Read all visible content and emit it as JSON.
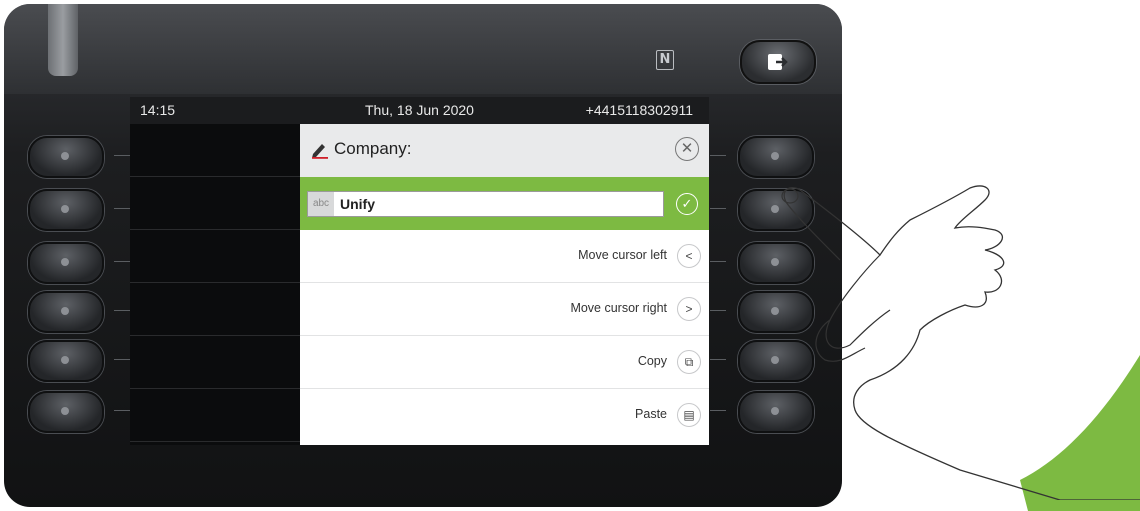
{
  "status_bar": {
    "time": "14:15",
    "date": "Thu, 18 Jun 2020",
    "number": "+4415118302911"
  },
  "panel": {
    "title": "Company:",
    "input": {
      "prefix": "abc",
      "value": "Unify"
    },
    "options": [
      {
        "label": "Move cursor left",
        "icon": "chevron-left-icon"
      },
      {
        "label": "Move cursor right",
        "icon": "chevron-right-icon"
      },
      {
        "label": "Copy",
        "icon": "copy-icon"
      },
      {
        "label": "Paste",
        "icon": "paste-icon"
      }
    ]
  },
  "colors": {
    "accent": "#7dba42",
    "device": "#1d1e20"
  }
}
